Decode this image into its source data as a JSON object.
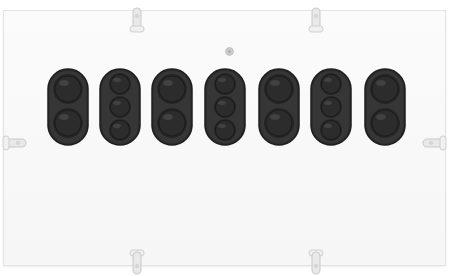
{
  "panel": {
    "background": "#f7f7f7",
    "module_color": "#2b2b2b",
    "light_color": "#2f2f2f",
    "modules": [
      {
        "id": "m1",
        "type": "two-light"
      },
      {
        "id": "m2",
        "type": "three-light"
      },
      {
        "id": "m3",
        "type": "two-light"
      },
      {
        "id": "m4",
        "type": "three-light"
      },
      {
        "id": "m5",
        "type": "two-light"
      },
      {
        "id": "m6",
        "type": "three-light"
      },
      {
        "id": "m7",
        "type": "two-light"
      }
    ],
    "clips": [
      "top-left",
      "top-right",
      "left",
      "right",
      "bottom-left",
      "bottom-right"
    ]
  }
}
